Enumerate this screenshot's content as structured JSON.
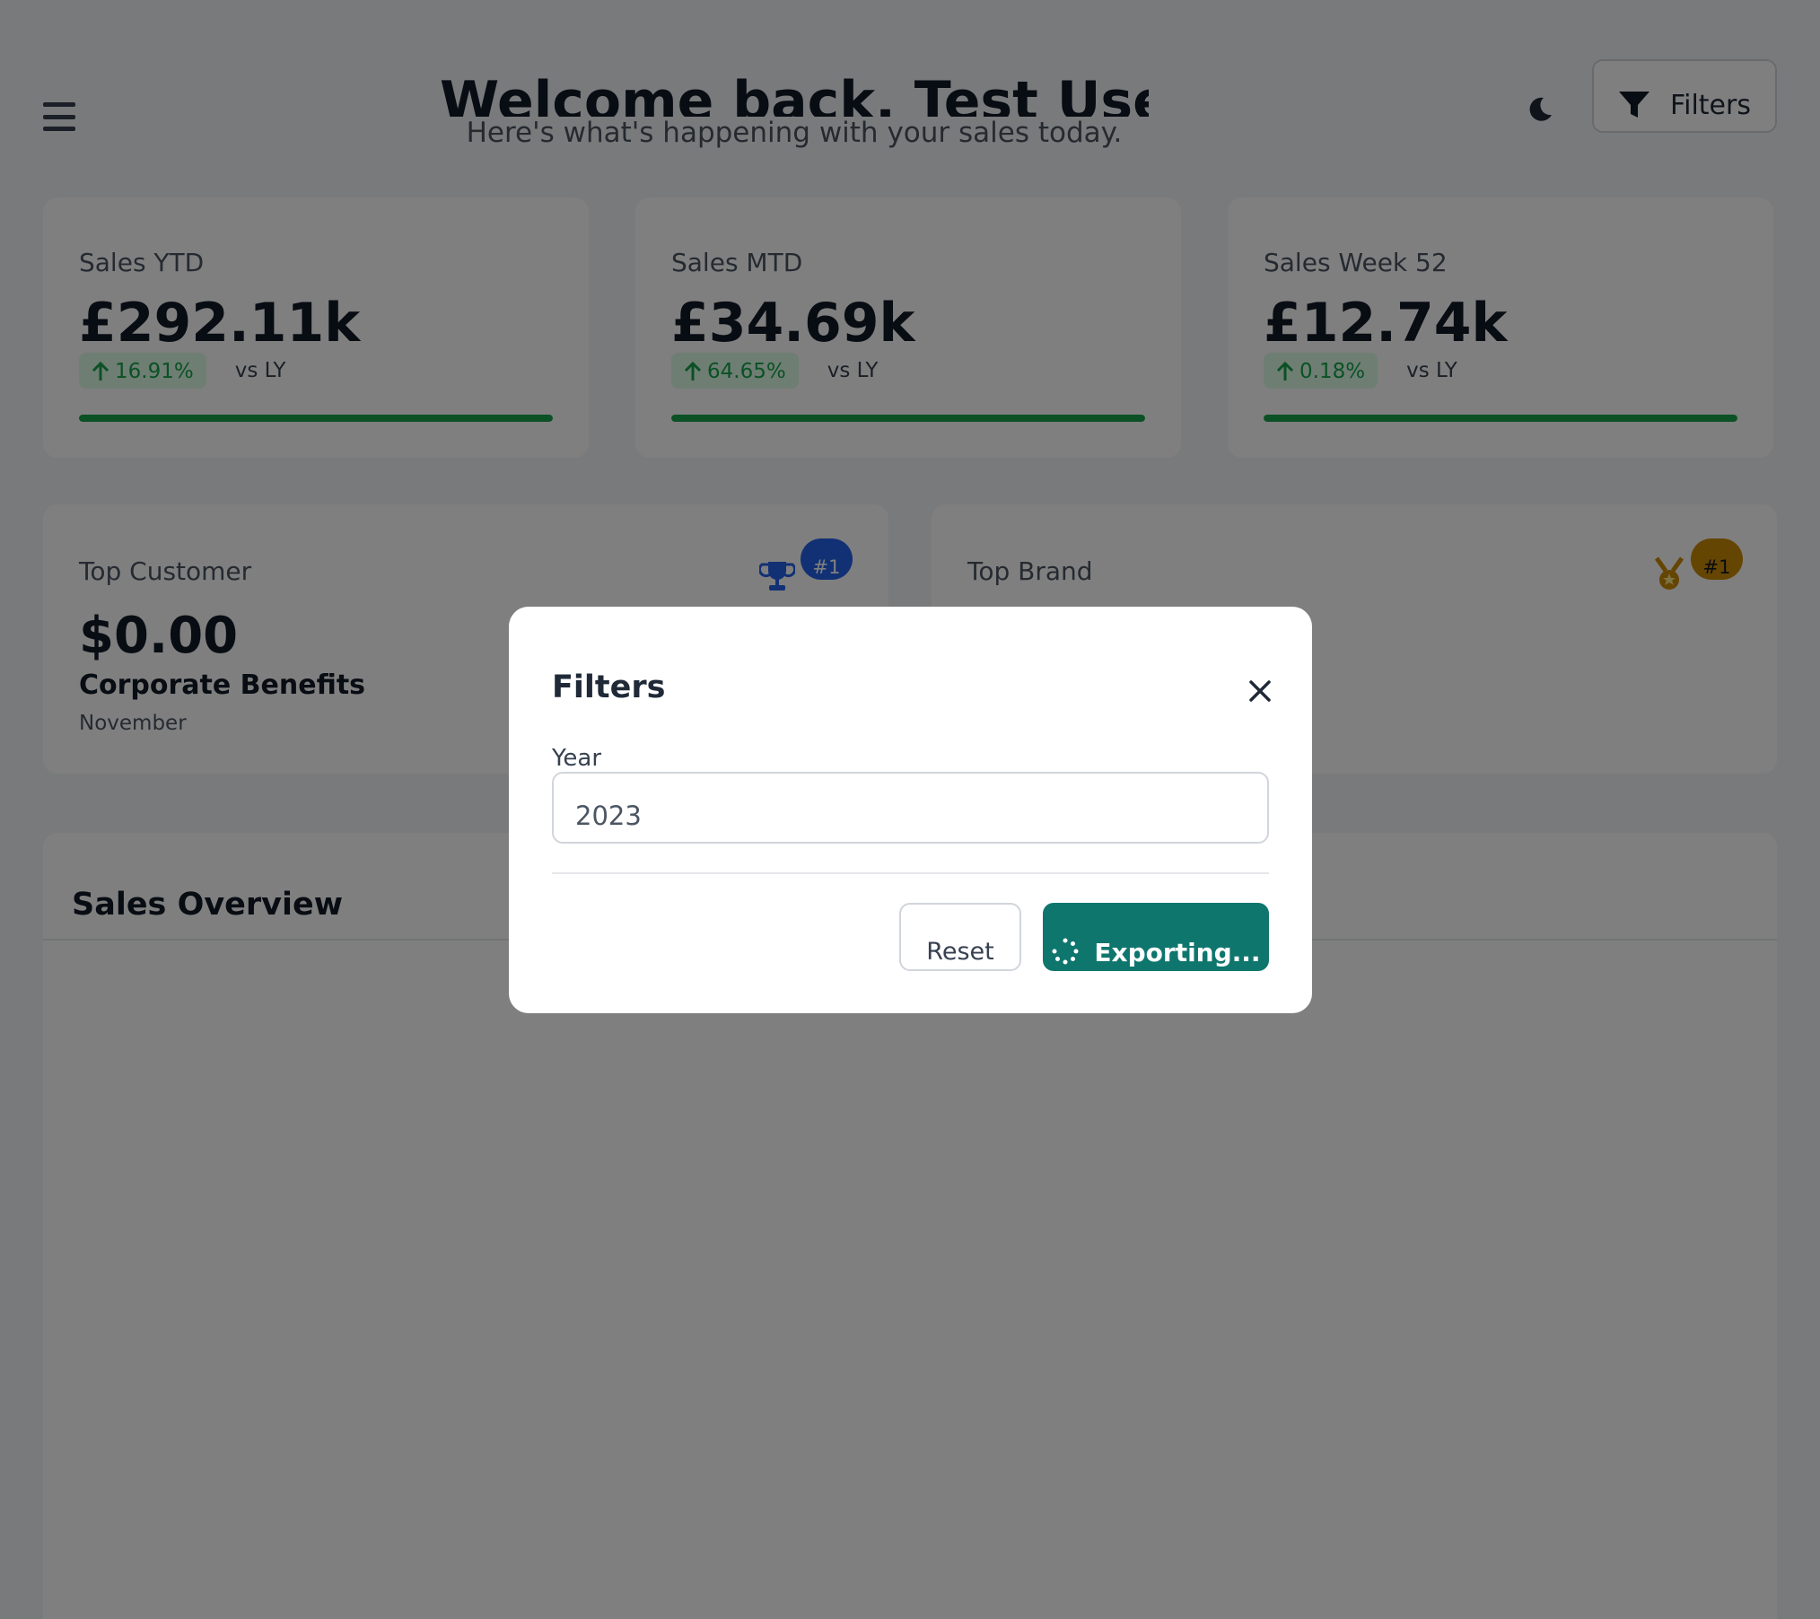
{
  "header": {
    "welcome": "Welcome back, Test User!",
    "subtitle": "Here's what's happening with your sales today.",
    "filters_label": "Filters"
  },
  "kpis": [
    {
      "label": "Sales YTD",
      "value": "£292.11k",
      "change": "16.91%",
      "vs": "vs LY",
      "progress": 1.0
    },
    {
      "label": "Sales MTD",
      "value": "£34.69k",
      "change": "64.65%",
      "vs": "vs LY",
      "progress": 1.0
    },
    {
      "label": "Sales Week 52",
      "value": "£12.74k",
      "change": "0.18%",
      "vs": "vs LY",
      "progress": 1.0
    }
  ],
  "top_customer": {
    "label": "Top Customer",
    "value": "$0.00",
    "name": "Corporate Benefits",
    "month": "November",
    "rank": "#1",
    "badge_color": "#2563eb"
  },
  "top_brand": {
    "label": "Top Brand",
    "rank": "#1",
    "badge_color": "#ca8a04"
  },
  "overview": {
    "title": "Sales Overview"
  },
  "modal": {
    "title": "Filters",
    "year_label": "Year",
    "year_value": "2023",
    "reset_label": "Reset",
    "export_label": "Exporting..."
  },
  "colors": {
    "positive": "#16a34a",
    "accent": "#0f766e"
  }
}
